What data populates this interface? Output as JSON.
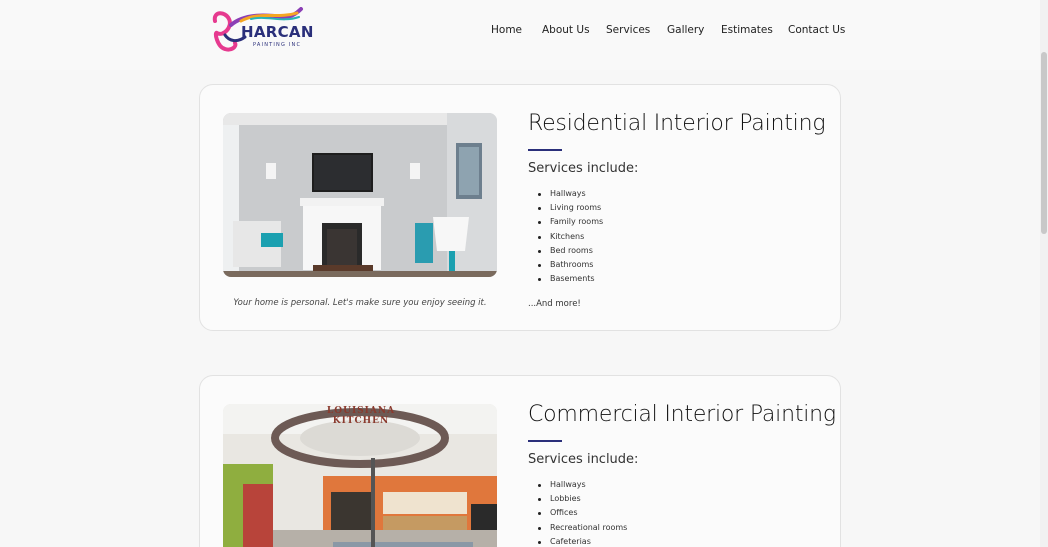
{
  "brand": {
    "name": "HARCAN",
    "tagline": "PAINTING INC",
    "colors": [
      "#e63a8f",
      "#f5a623",
      "#2a2f7a",
      "#28b5b5",
      "#8b3fb5"
    ]
  },
  "nav": {
    "items": [
      "Home",
      "About Us",
      "Services",
      "Gallery",
      "Estimates",
      "Contact Us"
    ]
  },
  "cards": [
    {
      "title": "Residential Interior Painting",
      "services_label": "Services include:",
      "services": [
        "Hallways",
        "Living rooms",
        "Family rooms",
        "Kitchens",
        "Bed rooms",
        "Bathrooms",
        "Basements"
      ],
      "more": "...And more!",
      "caption": "Your home is personal. Let's make sure you enjoy seeing it."
    },
    {
      "title": "Commercial Interior Painting",
      "services_label": "Services include:",
      "services": [
        "Hallways",
        "Lobbies",
        "Offices",
        "Recreational rooms",
        "Cafeterias"
      ],
      "sign_text": "LOUISIANA KITCHEN"
    }
  ]
}
